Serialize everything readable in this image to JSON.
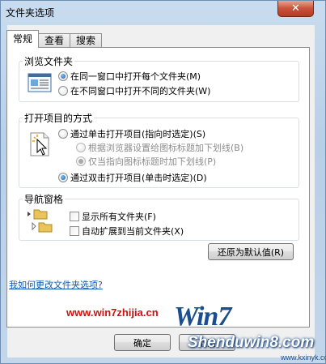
{
  "window": {
    "title": "文件夹选项",
    "close_glyph": "✕"
  },
  "tabs": [
    {
      "label": "常规",
      "active": true
    },
    {
      "label": "查看",
      "active": false
    },
    {
      "label": "搜索",
      "active": false
    }
  ],
  "browse_folders": {
    "title": "浏览文件夹",
    "options": [
      {
        "label": "在同一窗口中打开每个文件夹(M)",
        "checked": true
      },
      {
        "label": "在不同窗口中打开不同的文件夹(W)",
        "checked": false
      }
    ]
  },
  "click_items": {
    "title": "打开项目的方式",
    "options": [
      {
        "label": "通过单击打开项目(指向时选定)(S)",
        "checked": false,
        "disabled": false
      },
      {
        "label": "根据浏览器设置给图标标题加下划线(B)",
        "checked": false,
        "disabled": true
      },
      {
        "label": "仅当指向图标标题时加下划线(P)",
        "checked": true,
        "disabled": true
      },
      {
        "label": "通过双击打开项目(单击时选定)(D)",
        "checked": true,
        "disabled": false
      }
    ]
  },
  "nav_pane": {
    "title": "导航窗格",
    "options": [
      {
        "label": "显示所有文件夹(F)",
        "checked": false
      },
      {
        "label": "自动扩展到当前文件夹(X)",
        "checked": false
      }
    ]
  },
  "restore_button": "还原为默认值(R)",
  "help_link": "我如何更改文件夹选项?",
  "ok_button": "确定",
  "cancel_button": "取消",
  "watermark": {
    "site_text": "www.win7zhijia.cn",
    "logo_text": "Win7",
    "logo_site": "Shenduwin8.com",
    "logo_url": "www.kxinyk.com"
  },
  "colors": {
    "link": "#0c5ab5",
    "watermark_red": "#d01010",
    "radio_checked": "#1a5fa8"
  }
}
